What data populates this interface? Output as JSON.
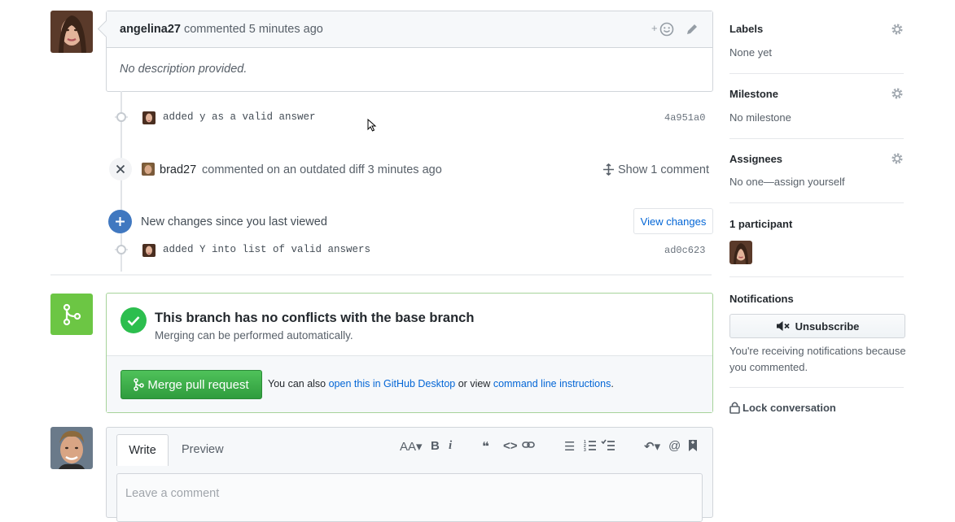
{
  "comment": {
    "author": "angelina27",
    "meta": "commented 5 minutes ago",
    "body": "No description provided.",
    "reaction_label": "+"
  },
  "timeline": {
    "commit1": {
      "message": "added y as a valid answer",
      "sha": "4a951a0"
    },
    "outdated": {
      "author": "brad27",
      "text": "commented on an outdated diff 3 minutes ago",
      "action": "Show 1 comment"
    },
    "new_changes": {
      "text": "New changes since you last viewed",
      "button": "View changes"
    },
    "commit2": {
      "message": "added Y into list of valid answers",
      "sha": "ad0c623"
    }
  },
  "merge": {
    "title": "This branch has no conflicts with the base branch",
    "subtitle": "Merging can be performed automatically.",
    "button": "Merge pull request",
    "also_prefix": "You can also",
    "desktop_link": "open this in GitHub Desktop",
    "or_view": "or view",
    "cli_link": "command line instructions",
    "period": "."
  },
  "editor": {
    "tab_write": "Write",
    "tab_preview": "Preview",
    "toolbar_text": "AA",
    "placeholder": "Leave a comment"
  },
  "sidebar": {
    "labels": {
      "heading": "Labels",
      "value": "None yet"
    },
    "milestone": {
      "heading": "Milestone",
      "value": "No milestone"
    },
    "assignees": {
      "heading": "Assignees",
      "value": "No one—assign yourself"
    },
    "participants": {
      "heading": "1 participant"
    },
    "notifications": {
      "heading": "Notifications",
      "button": "Unsubscribe",
      "description": "You're receiving notifications because you commented."
    },
    "lock": "Lock conversation"
  },
  "colors": {
    "link": "#0366d6",
    "merge_green": "#2ea44f",
    "merge_icon_bg": "#6cc644",
    "new_changes_blue": "#4078c0"
  }
}
